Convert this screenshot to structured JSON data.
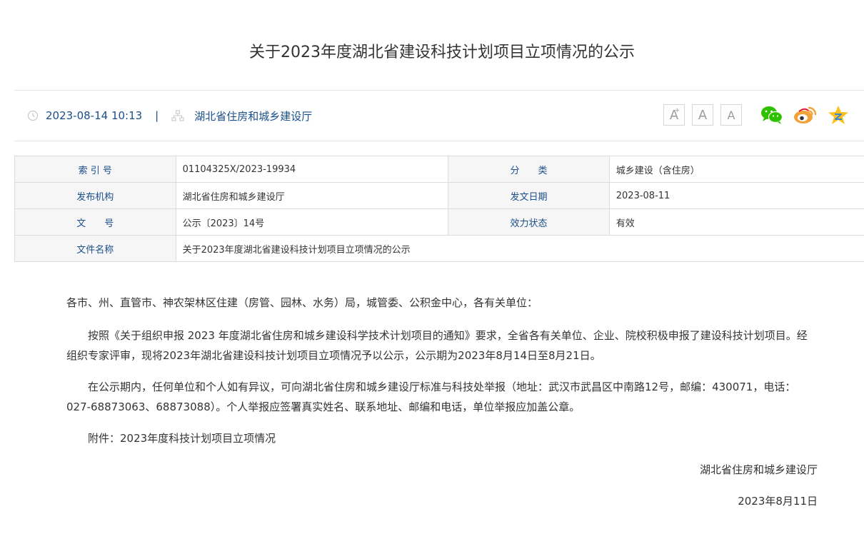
{
  "title": "关于2023年度湖北省建设科技计划项目立项情况的公示",
  "meta": {
    "datetime": "2023-08-14 10:13",
    "separator": "|",
    "publisher": "湖北省住房和城乡建设厅"
  },
  "tools": {
    "font_large": "A",
    "font_large_sup": "+",
    "font_medium": "A",
    "font_small": "A",
    "share_icons": [
      "wechat-icon",
      "weibo-icon",
      "qzone-icon"
    ]
  },
  "info_table": {
    "index_label": "索 引 号",
    "index_value": "01104325X/2023-19934",
    "category_label": "分　　类",
    "category_value": "城乡建设（含住房）",
    "agency_label": "发布机构",
    "agency_value": "湖北省住房和城乡建设厅",
    "issue_date_label": "发文日期",
    "issue_date_value": "2023-08-11",
    "doc_no_label": "文　　号",
    "doc_no_value": "公示〔2023〕14号",
    "status_label": "效力状态",
    "status_value": "有效",
    "filename_label": "文件名称",
    "filename_value": "关于2023年度湖北省建设科技计划项目立项情况的公示"
  },
  "body": {
    "greeting": "各市、州、直管市、神农架林区住建（房管、园林、水务）局，城管委、公积金中心，各有关单位：",
    "para1": "按照《关于组织申报 2023 年度湖北省住房和城乡建设科学技术计划项目的通知》要求，全省各有关单位、企业、院校积极申报了建设科技计划项目。经组织专家评审，现将2023年湖北省建设科技计划项目立项情况予以公示，公示期为2023年8月14日至8月21日。",
    "para2": "在公示期内，任何单位和个人如有异议，可向湖北省住房和城乡建设厅标准与科技处举报（地址：武汉市武昌区中南路12号，邮编：430071，电话：027-68873063、68873088）。个人举报应签署真实姓名、联系地址、邮编和电话，单位举报应加盖公章。",
    "attachment": "附件：2023年度科技计划项目立项情况",
    "signature_org": "湖北省住房和城乡建设厅",
    "signature_date": "2023年8月11日"
  },
  "colors": {
    "link_blue": "#1a4e8a",
    "label_bg": "#f6f6f6",
    "border": "#dcdcdc",
    "wechat_green": "#2dc100",
    "weibo_orange": "#e6162d",
    "qzone_yellow": "#fcc21b"
  }
}
